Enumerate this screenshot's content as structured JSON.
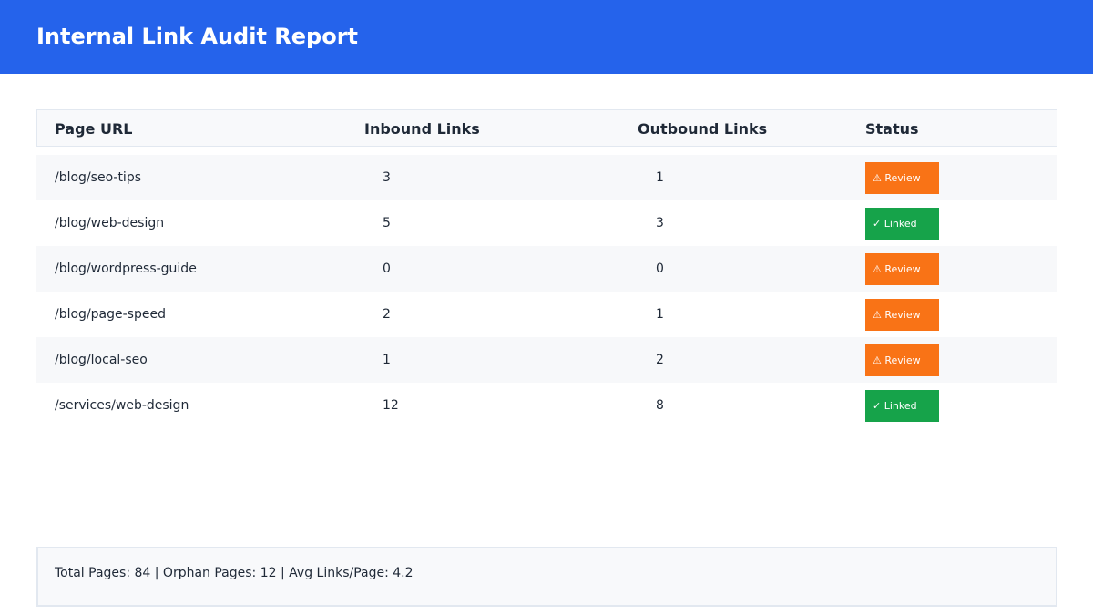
{
  "header": {
    "title": "Internal Link Audit Report",
    "background": "#2563eb"
  },
  "table": {
    "columns": [
      "Page URL",
      "Inbound Links",
      "Outbound Links",
      "Status"
    ],
    "rows": [
      {
        "url": "/blog/seo-tips",
        "inbound": "3",
        "outbound": "1",
        "status": "⚠ Review",
        "status_type": "review"
      },
      {
        "url": "/blog/web-design",
        "inbound": "5",
        "outbound": "3",
        "status": "✓ Linked",
        "status_type": "linked"
      },
      {
        "url": "/blog/wordpress-guide",
        "inbound": "0",
        "outbound": "0",
        "status": "⚠ Review",
        "status_type": "review"
      },
      {
        "url": "/blog/page-speed",
        "inbound": "2",
        "outbound": "1",
        "status": "⚠ Review",
        "status_type": "review"
      },
      {
        "url": "/blog/local-seo",
        "inbound": "1",
        "outbound": "2",
        "status": "⚠ Review",
        "status_type": "review"
      },
      {
        "url": "/services/web-design",
        "inbound": "12",
        "outbound": "8",
        "status": "✓ Linked",
        "status_type": "linked"
      }
    ]
  },
  "footer": {
    "summary": "Total Pages: 84 | Orphan Pages: 12 | Avg Links/Page: 4.2"
  },
  "colors": {
    "review": "#f97316",
    "linked": "#16a34a"
  }
}
